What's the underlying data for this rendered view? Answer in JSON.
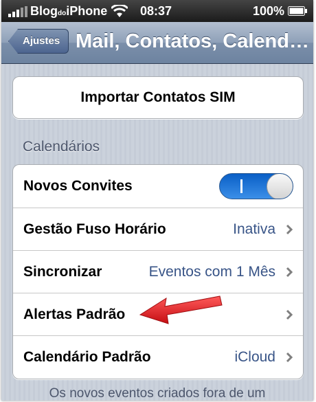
{
  "status_bar": {
    "carrier": "Blog",
    "carrier_small": "do",
    "carrier_end": "iPhone",
    "time": "08:37",
    "battery": "100%",
    "icons": [
      "signal-icon",
      "wifi-icon",
      "battery-icon"
    ]
  },
  "navbar": {
    "back_label": "Ajustes",
    "title": "Mail, Contatos, Calend…"
  },
  "import_button": {
    "label": "Importar Contatos SIM"
  },
  "calendars": {
    "header": "Calendários",
    "rows": [
      {
        "label": "Novos Convites",
        "toggle": "on"
      },
      {
        "label": "Gestão Fuso Horário",
        "value": "Inativa"
      },
      {
        "label": "Sincronizar",
        "value": "Eventos com 1 Mês"
      },
      {
        "label": "Alertas Padrão",
        "value": ""
      },
      {
        "label": "Calendário Padrão",
        "value": "iCloud"
      }
    ]
  },
  "footer": {
    "text": "Os novos eventos criados fora de um"
  },
  "colors": {
    "value_text": "#385487",
    "toggle_on": "#1d74da",
    "arrow": "#e8141b"
  }
}
